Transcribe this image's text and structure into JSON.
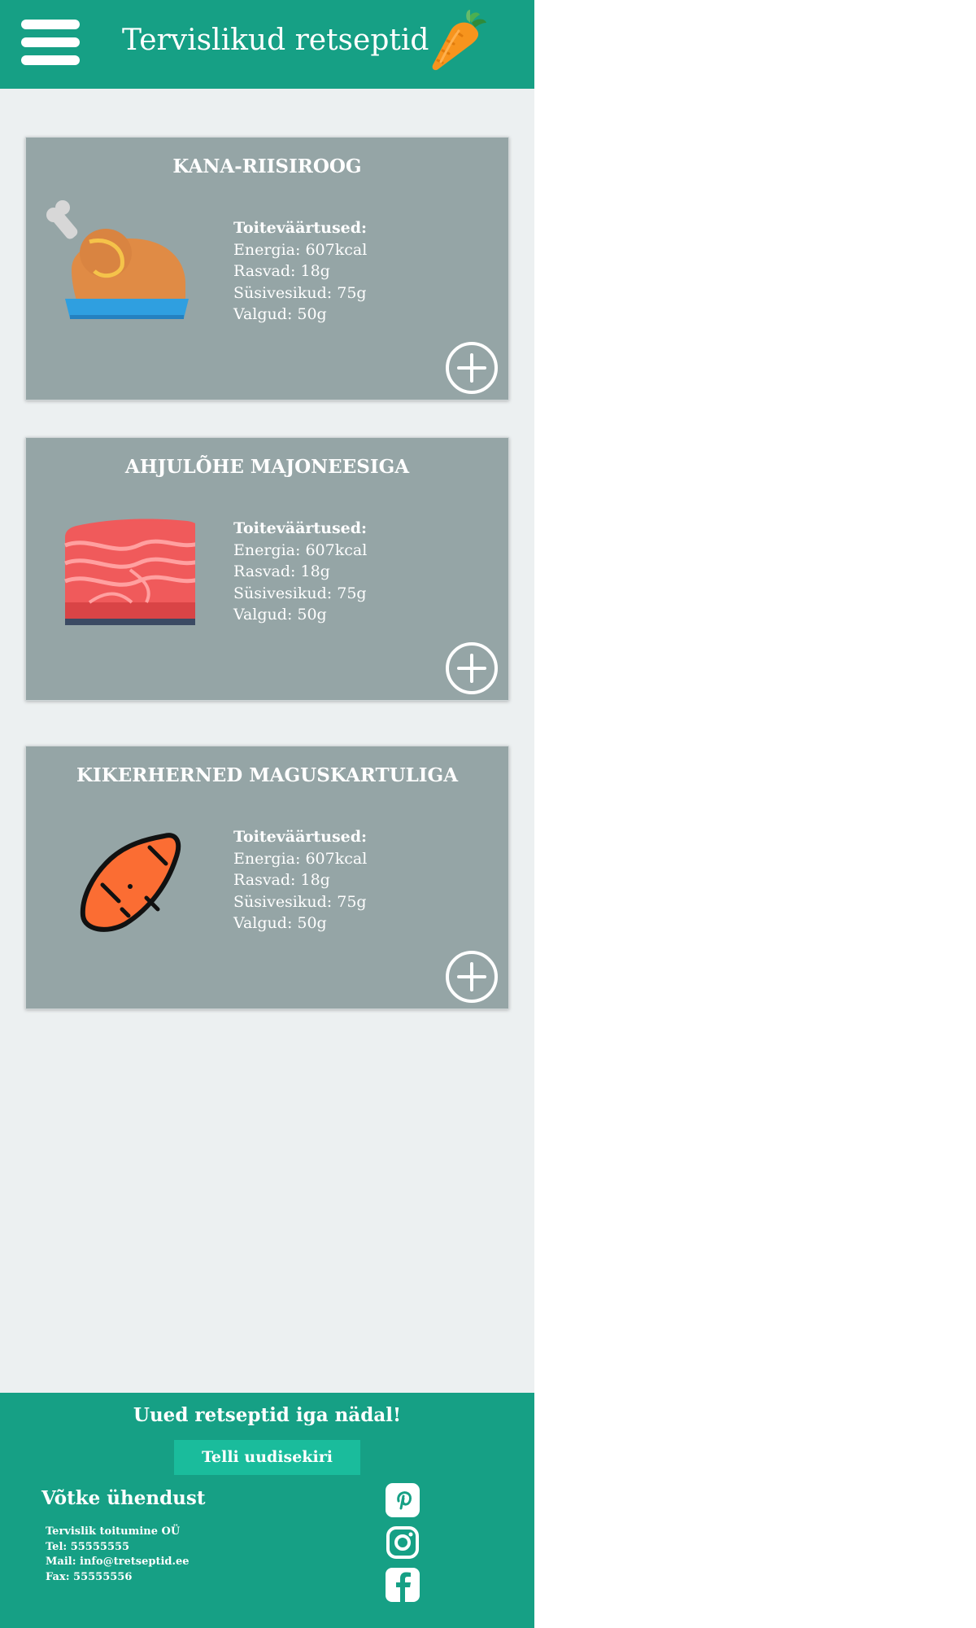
{
  "header": {
    "title": "Tervislikud retseptid",
    "menu_icon": "hamburger-menu-icon",
    "logo_icon": "carrot-icon"
  },
  "recipes": [
    {
      "title": "KANA-RIISIROOG",
      "image_icon": "roast-chicken-icon",
      "nutrition_heading": "Toiteväärtused:",
      "energy": "Energia:  607kcal",
      "fat": "Rasvad: 18g",
      "carbs": "Süsivesikud: 75g",
      "protein": "Valgud: 50g"
    },
    {
      "title": "AHJULÕHE MAJONEESIGA",
      "image_icon": "salmon-fillet-icon",
      "nutrition_heading": "Toiteväärtused:",
      "energy": "Energia:  607kcal",
      "fat": "Rasvad: 18g",
      "carbs": "Süsivesikud: 75g",
      "protein": "Valgud: 50g"
    },
    {
      "title": "KIKERHERNED MAGUSKARTULIGA",
      "image_icon": "sweet-potato-icon",
      "nutrition_heading": "Toiteväärtused:",
      "energy": "Energia:  607kcal",
      "fat": "Rasvad: 18g",
      "carbs": "Süsivesikud: 75g",
      "protein": "Valgud: 50g"
    }
  ],
  "footer": {
    "slogan": "Uued retseptid iga nädal!",
    "subscribe_label": "Telli uudisekiri",
    "contact_title": "Võtke ühendust",
    "company": "Tervislik toitumine OÜ",
    "phone": "Tel: 55555555",
    "mail": "Mail: info@tretseptid.ee",
    "fax": "Fax: 55555556",
    "social_icons": [
      "pinterest-icon",
      "instagram-icon",
      "facebook-icon"
    ]
  },
  "colors": {
    "primary": "#16a085",
    "accent": "#1abc9c",
    "card": "#95a5a6",
    "background": "#ecf0f1"
  }
}
